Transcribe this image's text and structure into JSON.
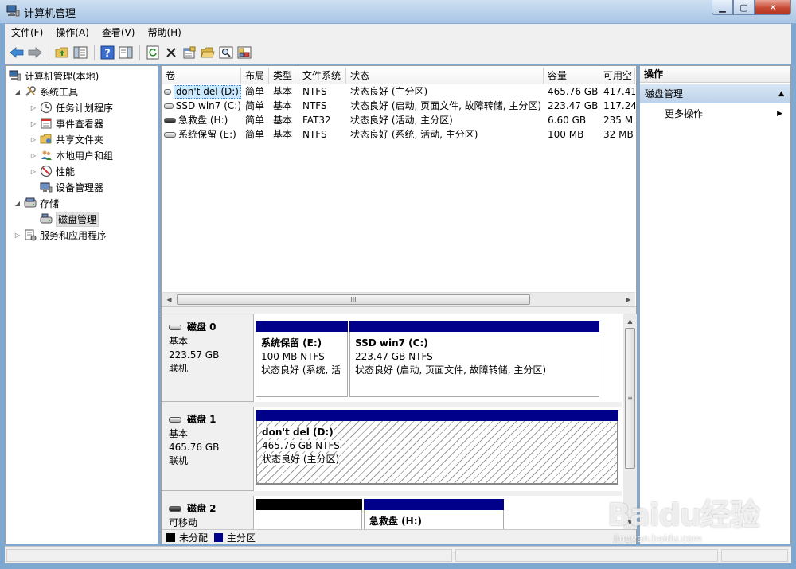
{
  "window": {
    "title": "计算机管理"
  },
  "menu": [
    "文件(F)",
    "操作(A)",
    "查看(V)",
    "帮助(H)"
  ],
  "tree": {
    "root": "计算机管理(本地)",
    "system_tools": "系统工具",
    "task_scheduler": "任务计划程序",
    "event_viewer": "事件查看器",
    "shared_folders": "共享文件夹",
    "local_users": "本地用户和组",
    "performance": "性能",
    "device_manager": "设备管理器",
    "storage": "存储",
    "disk_management": "磁盘管理",
    "services_apps": "服务和应用程序"
  },
  "volumes": {
    "columns": [
      "卷",
      "布局",
      "类型",
      "文件系统",
      "状态",
      "容量",
      "可用空"
    ],
    "rows": [
      [
        "don't del (D:)",
        "简单",
        "基本",
        "NTFS",
        "状态良好 (主分区)",
        "465.76 GB",
        "417.41"
      ],
      [
        "SSD win7 (C:)",
        "简单",
        "基本",
        "NTFS",
        "状态良好 (启动, 页面文件, 故障转储, 主分区)",
        "223.47 GB",
        "117.24"
      ],
      [
        "急救盘 (H:)",
        "简单",
        "基本",
        "FAT32",
        "状态良好 (活动, 主分区)",
        "6.60 GB",
        "235 M"
      ],
      [
        "系统保留 (E:)",
        "简单",
        "基本",
        "NTFS",
        "状态良好 (系统, 活动, 主分区)",
        "100 MB",
        "32 MB"
      ]
    ]
  },
  "scroll_glyph": "III",
  "disks": [
    {
      "name": "磁盘 0",
      "type": "基本",
      "size": "223.57 GB",
      "status": "联机"
    },
    {
      "name": "磁盘 1",
      "type": "基本",
      "size": "465.76 GB",
      "status": "联机"
    },
    {
      "name": "磁盘 2",
      "type": "可移动"
    }
  ],
  "partitions": {
    "sys_reserved": {
      "name": "系统保留  (E:)",
      "size": "100 MB NTFS",
      "status": "状态良好 (系统, 活"
    },
    "ssd_win7": {
      "name": "SSD win7  (C:)",
      "size": "223.47 GB NTFS",
      "status": "状态良好 (启动, 页面文件, 故障转储, 主分区)"
    },
    "dont_del": {
      "name": "don't del  (D:)",
      "size": "465.76 GB NTFS",
      "status": "状态良好 (主分区)"
    },
    "rescue": {
      "name": "急救盘  (H:)"
    }
  },
  "legend": {
    "unallocated": "未分配",
    "primary": "主分区"
  },
  "actions": {
    "header": "操作",
    "section": "磁盘管理",
    "more": "更多操作"
  },
  "watermark": {
    "logo": "Baidu经验",
    "url": "jingyan.baidu.com"
  },
  "colors": {
    "primary_partition": "#00008b",
    "unallocated": "#000000",
    "selection": "#cce8ff"
  }
}
